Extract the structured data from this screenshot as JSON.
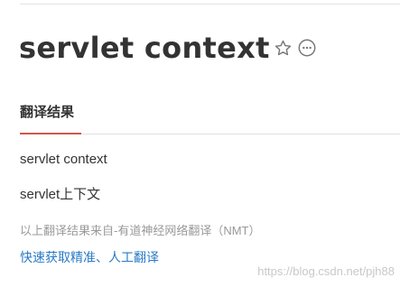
{
  "headword": "servlet context",
  "icons": {
    "favorite": "star-outline-icon",
    "more": "more-dots-icon"
  },
  "section_tab": "翻译结果",
  "result": {
    "original": "servlet context",
    "translation": "servlet上下文",
    "source_note": "以上翻译结果来自-有道神经网络翻译（NMT）",
    "quick_link": "快速获取精准、人工翻译"
  },
  "watermark": "https://blog.csdn.net/pjh88",
  "colors": {
    "accent_underline": "#d0574c",
    "link": "#2a7ac7",
    "muted_text": "#999999"
  }
}
